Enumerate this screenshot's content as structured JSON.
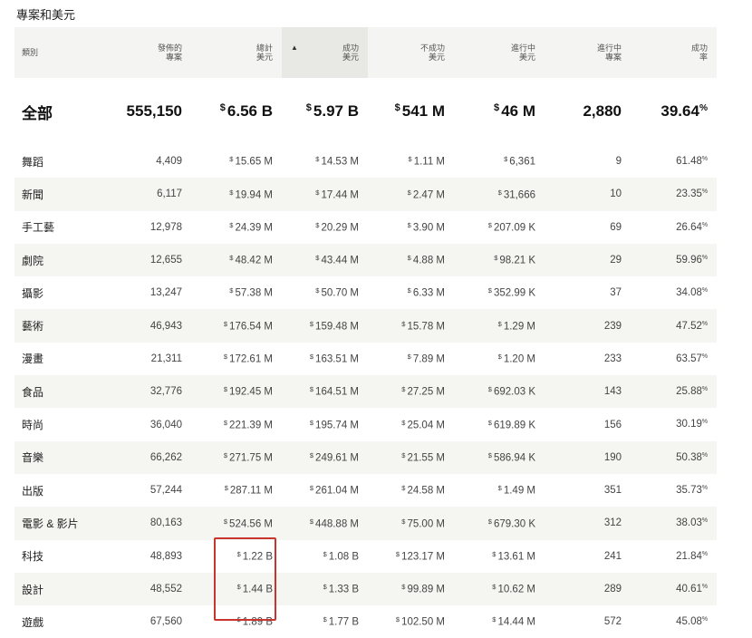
{
  "page_title": "專案和美元",
  "columns": [
    {
      "label": "類別"
    },
    {
      "label": "發佈的\n專案"
    },
    {
      "label": "總計\n美元"
    },
    {
      "label": "成功\n美元",
      "sorted": true,
      "sort_indicator": "▲"
    },
    {
      "label": "不成功\n美元"
    },
    {
      "label": "進行中\n美元"
    },
    {
      "label": "進行中\n專案"
    },
    {
      "label": "成功\n率"
    }
  ],
  "total": {
    "category": "全部",
    "launched": "555,150",
    "total_usd": "6.56 B",
    "successful_usd": "5.97 B",
    "unsuccessful_usd": "541 M",
    "live_usd": "46 M",
    "live_projects": "2,880",
    "success_rate": "39.64"
  },
  "currency_symbol": "$",
  "percent_symbol": "%",
  "rows": [
    {
      "category": "舞蹈",
      "launched": "4,409",
      "total_usd": "15.65 M",
      "successful_usd": "14.53 M",
      "unsuccessful_usd": "1.11 M",
      "live_usd": "6,361",
      "live_projects": "9",
      "success_rate": "61.48"
    },
    {
      "category": "新聞",
      "launched": "6,117",
      "total_usd": "19.94 M",
      "successful_usd": "17.44 M",
      "unsuccessful_usd": "2.47 M",
      "live_usd": "31,666",
      "live_projects": "10",
      "success_rate": "23.35"
    },
    {
      "category": "手工藝",
      "launched": "12,978",
      "total_usd": "24.39 M",
      "successful_usd": "20.29 M",
      "unsuccessful_usd": "3.90 M",
      "live_usd": "207.09 K",
      "live_projects": "69",
      "success_rate": "26.64"
    },
    {
      "category": "劇院",
      "launched": "12,655",
      "total_usd": "48.42 M",
      "successful_usd": "43.44 M",
      "unsuccessful_usd": "4.88 M",
      "live_usd": "98.21 K",
      "live_projects": "29",
      "success_rate": "59.96"
    },
    {
      "category": "攝影",
      "launched": "13,247",
      "total_usd": "57.38 M",
      "successful_usd": "50.70 M",
      "unsuccessful_usd": "6.33 M",
      "live_usd": "352.99 K",
      "live_projects": "37",
      "success_rate": "34.08"
    },
    {
      "category": "藝術",
      "launched": "46,943",
      "total_usd": "176.54 M",
      "successful_usd": "159.48 M",
      "unsuccessful_usd": "15.78 M",
      "live_usd": "1.29 M",
      "live_projects": "239",
      "success_rate": "47.52"
    },
    {
      "category": "漫畫",
      "launched": "21,311",
      "total_usd": "172.61 M",
      "successful_usd": "163.51 M",
      "unsuccessful_usd": "7.89 M",
      "live_usd": "1.20 M",
      "live_projects": "233",
      "success_rate": "63.57"
    },
    {
      "category": "食品",
      "launched": "32,776",
      "total_usd": "192.45 M",
      "successful_usd": "164.51 M",
      "unsuccessful_usd": "27.25 M",
      "live_usd": "692.03 K",
      "live_projects": "143",
      "success_rate": "25.88"
    },
    {
      "category": "時尚",
      "launched": "36,040",
      "total_usd": "221.39 M",
      "successful_usd": "195.74 M",
      "unsuccessful_usd": "25.04 M",
      "live_usd": "619.89 K",
      "live_projects": "156",
      "success_rate": "30.19"
    },
    {
      "category": "音樂",
      "launched": "66,262",
      "total_usd": "271.75 M",
      "successful_usd": "249.61 M",
      "unsuccessful_usd": "21.55 M",
      "live_usd": "586.94 K",
      "live_projects": "190",
      "success_rate": "50.38"
    },
    {
      "category": "出版",
      "launched": "57,244",
      "total_usd": "287.11 M",
      "successful_usd": "261.04 M",
      "unsuccessful_usd": "24.58 M",
      "live_usd": "1.49 M",
      "live_projects": "351",
      "success_rate": "35.73"
    },
    {
      "category": "電影 & 影片",
      "launched": "80,163",
      "total_usd": "524.56 M",
      "successful_usd": "448.88 M",
      "unsuccessful_usd": "75.00 M",
      "live_usd": "679.30 K",
      "live_projects": "312",
      "success_rate": "38.03"
    },
    {
      "category": "科技",
      "launched": "48,893",
      "total_usd": "1.22 B",
      "successful_usd": "1.08 B",
      "unsuccessful_usd": "123.17 M",
      "live_usd": "13.61 M",
      "live_projects": "241",
      "success_rate": "21.84"
    },
    {
      "category": "設計",
      "launched": "48,552",
      "total_usd": "1.44 B",
      "successful_usd": "1.33 B",
      "unsuccessful_usd": "99.89 M",
      "live_usd": "10.62 M",
      "live_projects": "289",
      "success_rate": "40.61"
    },
    {
      "category": "遊戲",
      "launched": "67,560",
      "total_usd": "1.89 B",
      "successful_usd": "1.77 B",
      "unsuccessful_usd": "102.50 M",
      "live_usd": "14.44 M",
      "live_projects": "572",
      "success_rate": "45.08"
    }
  ],
  "colors": {
    "header_bg": "#f4f4f2",
    "stripe_bg": "#f5f5f2",
    "highlight": "#c8352f"
  }
}
